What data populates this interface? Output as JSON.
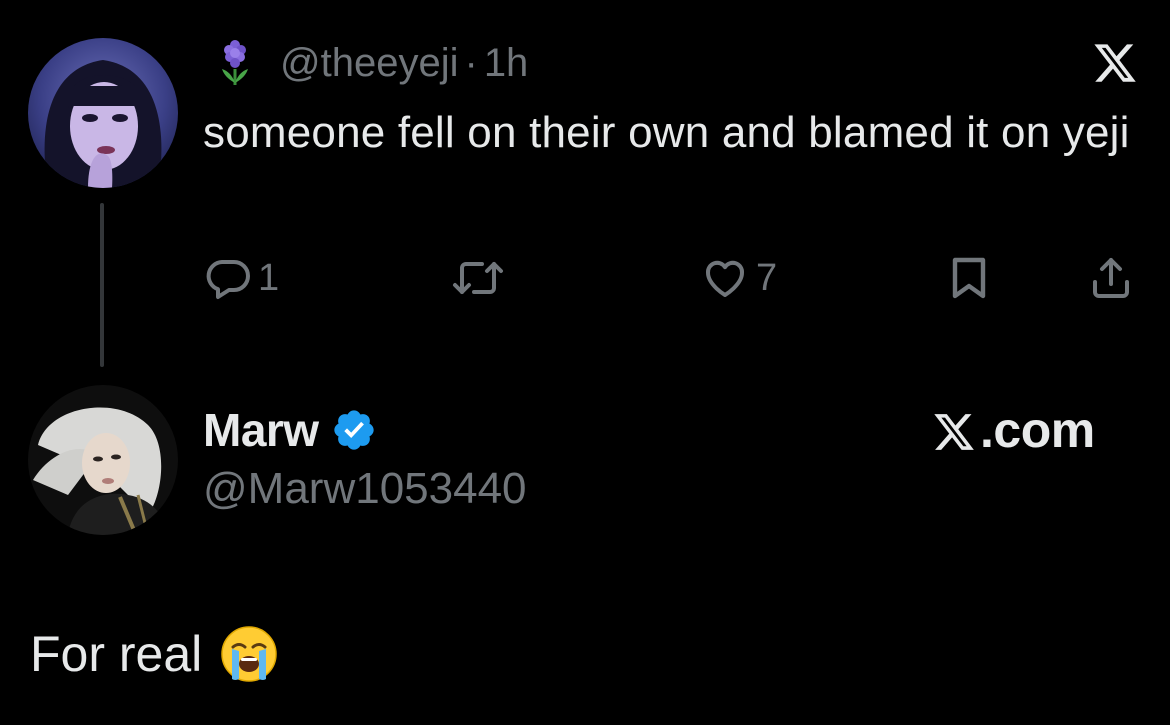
{
  "quoted_tweet": {
    "emoji_icon": "hyacinth-icon",
    "handle": "@theeyeji",
    "separator": "·",
    "time": "1h",
    "text": "someone fell on their own and blamed it on yeji",
    "actions": {
      "reply_icon": "reply-icon",
      "reply_count": "1",
      "retweet_icon": "retweet-icon",
      "like_icon": "heart-icon",
      "like_count": "7",
      "bookmark_icon": "bookmark-icon",
      "share_icon": "share-icon"
    }
  },
  "reply": {
    "display_name": "Marw",
    "verified_icon": "verified-badge-icon",
    "handle": "@Marw1053440",
    "brand_label": ".com",
    "text": "For real",
    "emoji": "loudly-crying-face-icon"
  },
  "colors": {
    "background": "#000000",
    "primary_text": "#e7e9ea",
    "secondary_text": "#71767b",
    "verified_blue": "#1d9bf0",
    "thread_line": "#333639"
  }
}
